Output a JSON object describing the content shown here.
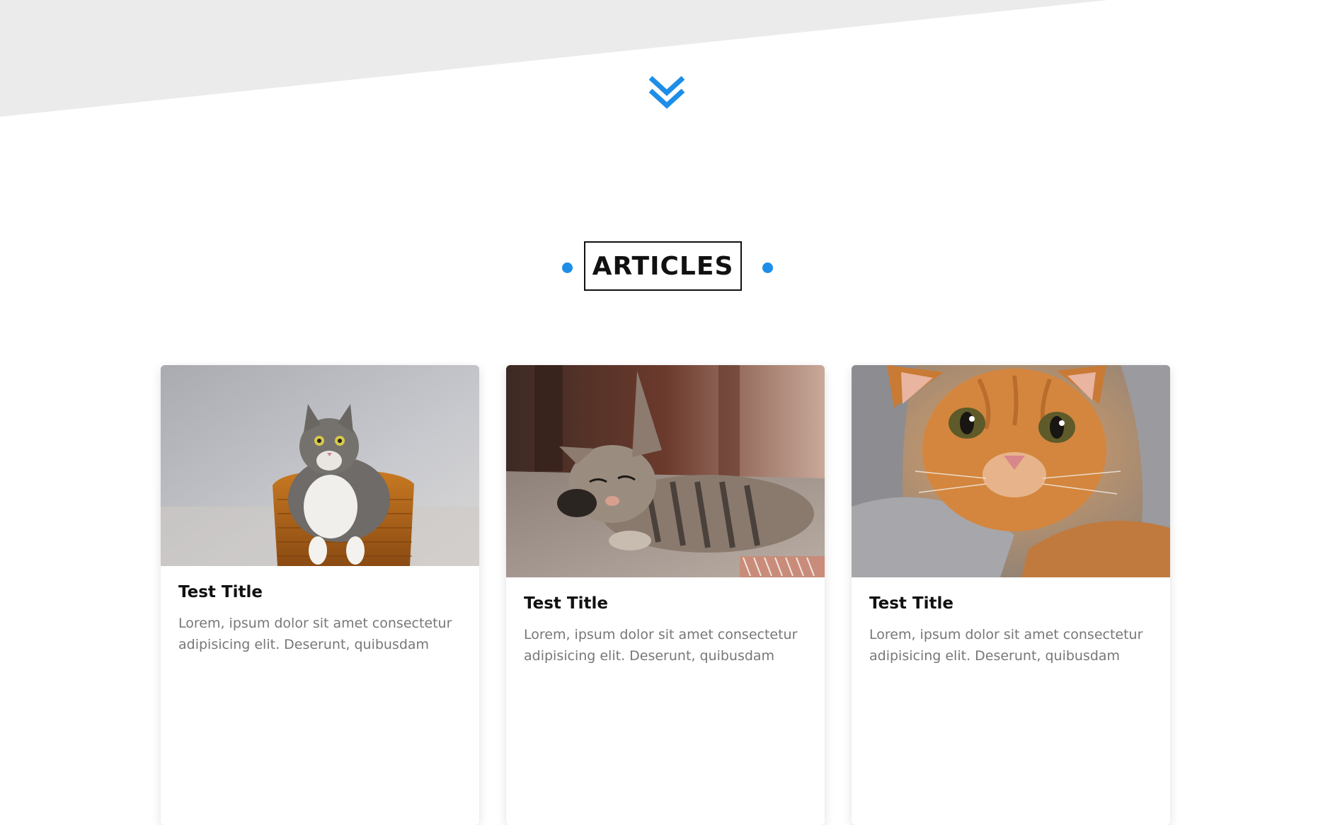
{
  "section": {
    "heading": "ARTICLES"
  },
  "colors": {
    "accent": "#1e8ee8",
    "hero_background": "#ebebeb"
  },
  "icons": {
    "scroll_down": "double-chevron-down-icon"
  },
  "articles": [
    {
      "title": "Test Title",
      "excerpt": "Lorem, ipsum dolor sit amet consectetur adipisicing elit. Deserunt, quibusdam",
      "image": "grey-and-white-cat-in-wicker-basket"
    },
    {
      "title": "Test Title",
      "excerpt": "Lorem, ipsum dolor sit amet consectetur adipisicing elit. Deserunt, quibusdam",
      "image": "tabby-kitten-sleeping"
    },
    {
      "title": "Test Title",
      "excerpt": "Lorem, ipsum dolor sit amet consectetur adipisicing elit. Deserunt, quibusdam",
      "image": "orange-kitten-in-blanket"
    }
  ]
}
